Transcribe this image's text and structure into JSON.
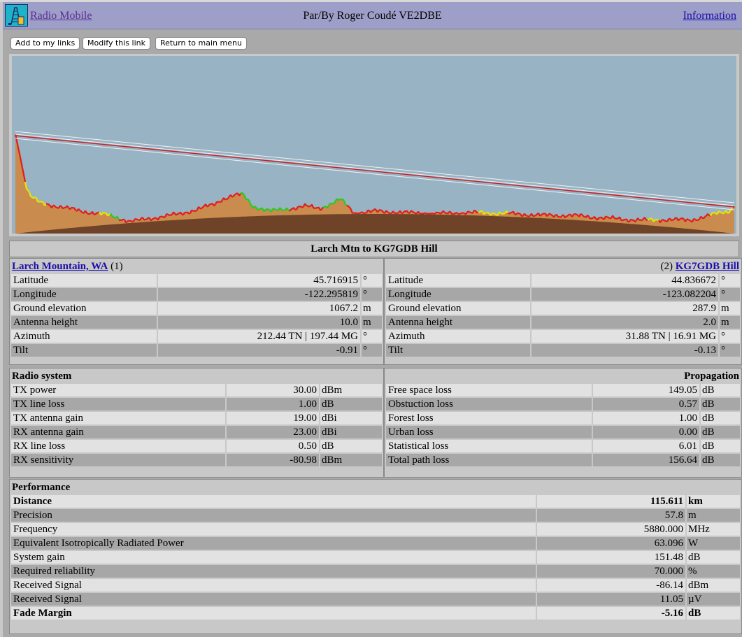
{
  "header": {
    "app_name": "Radio Mobile",
    "author": "Par/By Roger Coudé VE2DBE",
    "info_link": "Information"
  },
  "toolbar": {
    "add_link": "Add to my links",
    "modify_link": "Modify this link",
    "return_menu": "Return to main menu"
  },
  "colors": {
    "sky": "#98b3c4",
    "terrain": "#c98c4e",
    "earth_bulge": "#6e4328",
    "obstructed": "#e41b17",
    "clear": "#2ec81e",
    "marginal": "#e6e600",
    "los_line": "#d0191d",
    "fresnel": "#f2f2f2"
  },
  "link_title": "Larch Mtn to KG7GDB Hill",
  "site1": {
    "name": "Larch Mountain, WA",
    "index": "(1)",
    "rows": [
      {
        "label": "Latitude",
        "value": "45.716915",
        "unit": "°"
      },
      {
        "label": "Longitude",
        "value": "-122.295819",
        "unit": "°"
      },
      {
        "label": "Ground elevation",
        "value": "1067.2",
        "unit": "m"
      },
      {
        "label": "Antenna height",
        "value": "10.0",
        "unit": "m"
      },
      {
        "label": "Azimuth",
        "value": "212.44 TN | 197.44 MG",
        "unit": "°"
      },
      {
        "label": "Tilt",
        "value": "-0.91",
        "unit": "°"
      }
    ]
  },
  "site2": {
    "name": "KG7GDB Hill",
    "index": "(2)",
    "rows": [
      {
        "label": "Latitude",
        "value": "44.836672",
        "unit": "°"
      },
      {
        "label": "Longitude",
        "value": "-123.082204",
        "unit": "°"
      },
      {
        "label": "Ground elevation",
        "value": "287.9",
        "unit": "m"
      },
      {
        "label": "Antenna height",
        "value": "2.0",
        "unit": "m"
      },
      {
        "label": "Azimuth",
        "value": "31.88 TN | 16.91 MG",
        "unit": "°"
      },
      {
        "label": "Tilt",
        "value": "-0.13",
        "unit": "°"
      }
    ]
  },
  "radio": {
    "title": "Radio system",
    "rows": [
      {
        "label": "TX power",
        "value": "30.00",
        "unit": "dBm"
      },
      {
        "label": "TX line loss",
        "value": "1.00",
        "unit": "dB"
      },
      {
        "label": "TX antenna gain",
        "value": "19.00",
        "unit": "dBi"
      },
      {
        "label": "RX antenna gain",
        "value": "23.00",
        "unit": "dBi"
      },
      {
        "label": "RX line loss",
        "value": "0.50",
        "unit": "dB"
      },
      {
        "label": "RX sensitivity",
        "value": "-80.98",
        "unit": "dBm"
      }
    ]
  },
  "propagation": {
    "title": "Propagation",
    "rows": [
      {
        "label": "Free space loss",
        "value": "149.05",
        "unit": "dB"
      },
      {
        "label": "Obstuction loss",
        "value": "0.57",
        "unit": "dB"
      },
      {
        "label": "Forest loss",
        "value": "1.00",
        "unit": "dB"
      },
      {
        "label": "Urban loss",
        "value": "0.00",
        "unit": "dB"
      },
      {
        "label": "Statistical loss",
        "value": "6.01",
        "unit": "dB"
      },
      {
        "label": "Total path loss",
        "value": "156.64",
        "unit": "dB"
      }
    ]
  },
  "performance": {
    "title": "Performance",
    "rows": [
      {
        "label": "Distance",
        "value": "115.611",
        "unit": "km",
        "bold": true
      },
      {
        "label": "Precision",
        "value": "57.8",
        "unit": "m"
      },
      {
        "label": "Frequency",
        "value": "5880.000",
        "unit": "MHz"
      },
      {
        "label": "Equivalent Isotropically Radiated Power",
        "value": "63.096",
        "unit": "W"
      },
      {
        "label": "System gain",
        "value": "151.48",
        "unit": "dB"
      },
      {
        "label": "Required reliability",
        "value": "70.000",
        "unit": "%"
      },
      {
        "label": "Received Signal",
        "value": "-86.14",
        "unit": "dBm"
      },
      {
        "label": "Received Signal",
        "value": "11.05",
        "unit": "µV"
      },
      {
        "label": "Fade Margin",
        "value": "-5.16",
        "unit": "dB",
        "bold": true
      }
    ]
  }
}
